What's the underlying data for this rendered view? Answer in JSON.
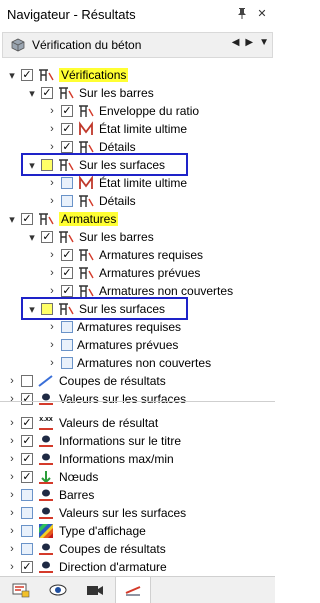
{
  "window": {
    "title": "Navigateur - Résultats"
  },
  "view_selector": {
    "label": "Vérification du béton"
  },
  "tree": {
    "verifications": "Vérifications",
    "sur_les_barres_1": "Sur les barres",
    "enveloppe_ratio": "Enveloppe du ratio",
    "etat_limite_1": "État limite ultime",
    "details_1": "Détails",
    "sur_les_surfaces_1": "Sur les surfaces",
    "etat_limite_2": "État limite ultime",
    "details_2": "Détails",
    "armatures": "Armatures",
    "sur_les_barres_2": "Sur les barres",
    "arm_requises_1": "Armatures requises",
    "arm_prevues_1": "Armatures prévues",
    "arm_non_couvertes_1": "Armatures non couvertes",
    "sur_les_surfaces_2": "Sur les surfaces",
    "arm_requises_2": "Armatures requises",
    "arm_prevues_2": "Armatures prévues",
    "arm_non_couvertes_2": "Armatures non couvertes",
    "coupes_resultats_1": "Coupes de résultats",
    "valeurs_surfaces_1": "Valeurs sur les surfaces"
  },
  "display": {
    "valeurs_resultat": "Valeurs de résultat",
    "valeurs_badge": "x.xx",
    "info_titre": "Informations sur le titre",
    "info_maxmin": "Informations max/min",
    "noeuds": "Nœuds",
    "barres": "Barres",
    "valeurs_surfaces_2": "Valeurs sur les surfaces",
    "type_affichage": "Type d'affichage",
    "coupes_resultats_2": "Coupes de résultats",
    "direction_armature": "Direction d'armature"
  },
  "colors": {
    "highlight": "#ffff33",
    "callout_border": "#1e23c8",
    "accent": "#d43a2a"
  }
}
